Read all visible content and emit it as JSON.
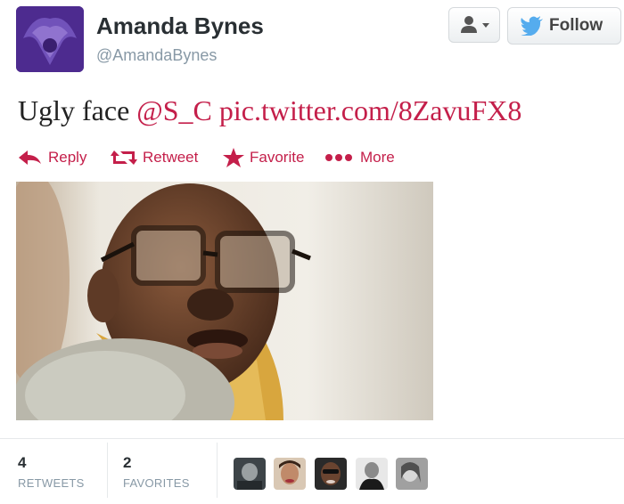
{
  "author": {
    "name": "Amanda Bynes",
    "handle": "@AmandaBynes"
  },
  "header": {
    "follow_label": "Follow",
    "user_menu_icon": "person-dropdown-icon",
    "follow_icon": "twitter-bird-icon"
  },
  "tweet": {
    "text_prefix": "Ugly face",
    "mention": "@S_C",
    "link": "pic.twitter.com/8ZavuFX8"
  },
  "actions": [
    {
      "label": "Reply",
      "icon": "reply-arrow-icon"
    },
    {
      "label": "Retweet",
      "icon": "retweet-icon"
    },
    {
      "label": "Favorite",
      "icon": "star-icon"
    },
    {
      "label": "More",
      "icon": "more-dots-icon"
    }
  ],
  "stats": {
    "retweets_count": "4",
    "retweets_label": "RETWEETS",
    "favorites_count": "2",
    "favorites_label": "FAVORITES"
  },
  "colors": {
    "link": "#c41f4a",
    "name": "#292f33",
    "muted": "#8899a6",
    "twitter_blue": "#55acee"
  }
}
